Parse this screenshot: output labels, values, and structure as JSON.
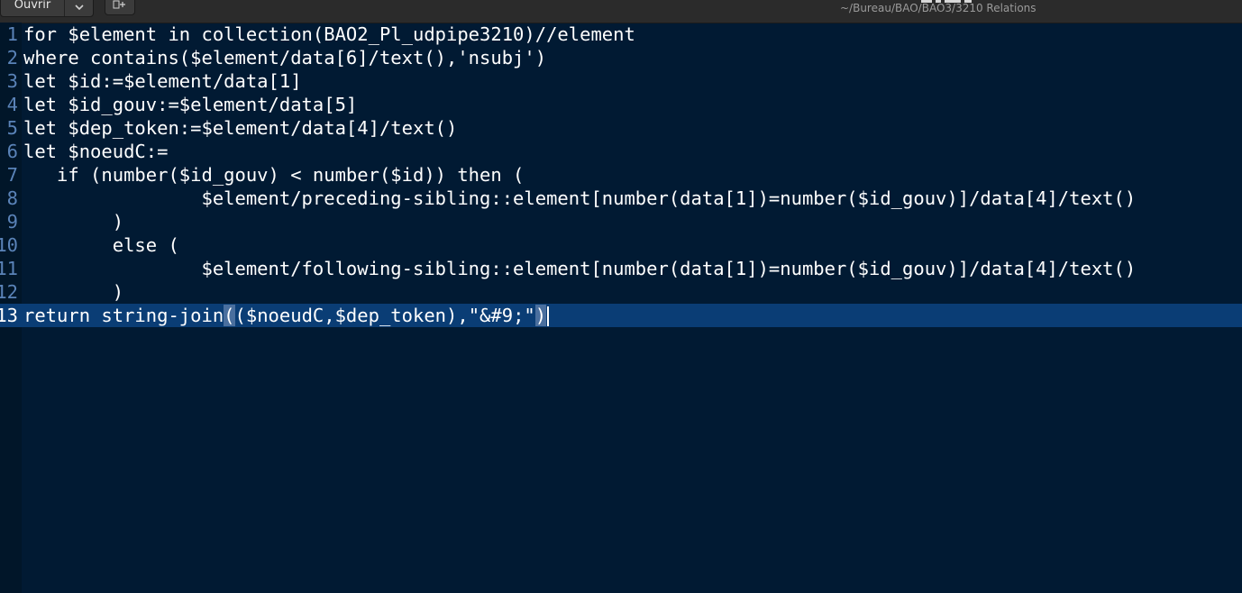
{
  "header": {
    "open_label": "Ouvrir",
    "new_tab_label": "+",
    "subtitle": "~/Bureau/BAO/BAO3/3210 Relations"
  },
  "editor": {
    "lines": [
      {
        "num": "1",
        "text": "for $element in collection(BAO2_Pl_udpipe3210)//element"
      },
      {
        "num": "2",
        "text": "where contains($element/data[6]/text(),'nsubj')"
      },
      {
        "num": "3",
        "text": "let $id:=$element/data[1]"
      },
      {
        "num": "4",
        "text": "let $id_gouv:=$element/data[5]"
      },
      {
        "num": "5",
        "text": "let $dep_token:=$element/data[4]/text()"
      },
      {
        "num": "6",
        "text": "let $noeudC:="
      },
      {
        "num": "7",
        "text": "   if (number($id_gouv) < number($id)) then ("
      },
      {
        "num": "8",
        "text": "                $element/preceding-sibling::element[number(data[1])=number($id_gouv)]/data[4]/text()"
      },
      {
        "num": "9",
        "text": "        )"
      },
      {
        "num": "10",
        "text": "        else ("
      },
      {
        "num": "11",
        "text": "                $element/following-sibling::element[number(data[1])=number($id_gouv)]/data[4]/text()"
      },
      {
        "num": "12",
        "text": "        )"
      }
    ],
    "current_line": {
      "num": "13",
      "before": "return string-join",
      "open_paren": "(",
      "middle": "($noeudC,$dep_token),\"&#9;\"",
      "close_paren": ")"
    }
  }
}
